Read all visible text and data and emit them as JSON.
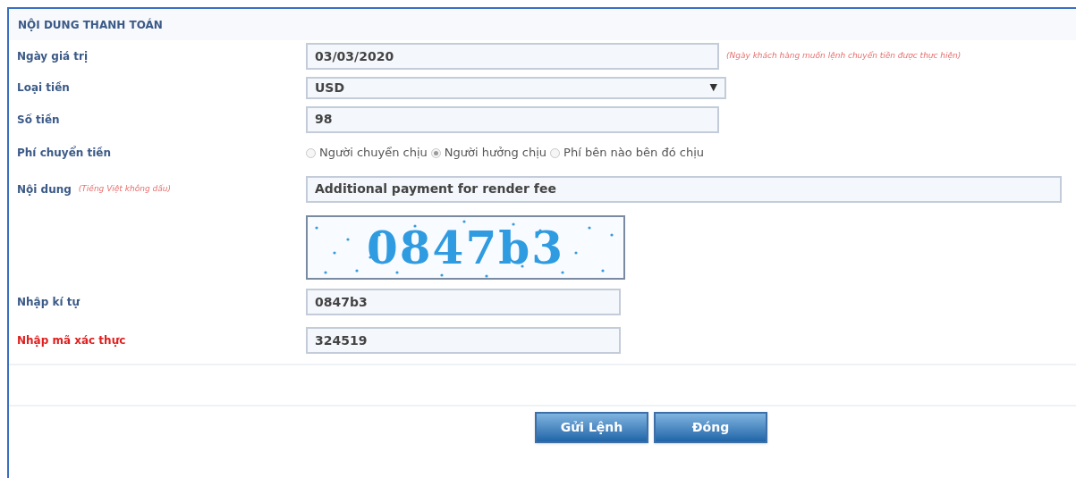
{
  "section_title": "NỘI DUNG THANH TOÁN",
  "value_date": {
    "label": "Ngày giá trị",
    "value": "03/03/2020",
    "hint": "(Ngày khách hàng muốn lệnh chuyển tiền được thực hiện)"
  },
  "currency": {
    "label": "Loại tiền",
    "value": "USD",
    "arrow": "▼"
  },
  "amount": {
    "label": "Số tiền",
    "value": "98"
  },
  "fee": {
    "label": "Phí chuyển tiền",
    "options": [
      {
        "label": "Người chuyển chịu",
        "selected": false
      },
      {
        "label": "Người hưởng chịu",
        "selected": true
      },
      {
        "label": "Phí bên nào bên đó chịu",
        "selected": false
      }
    ]
  },
  "content": {
    "label": "Nội dung",
    "note": "(Tiếng Việt không dấu)",
    "value": "Additional payment for render fee"
  },
  "captcha": "0847b3",
  "captcha_input": {
    "label": "Nhập kí tự",
    "value": "0847b3",
    "required": false
  },
  "otp_input": {
    "label": "Nhập mã xác thực",
    "value": "324519",
    "required": true
  },
  "buttons": [
    "Gửi Lệnh",
    "Đóng"
  ]
}
